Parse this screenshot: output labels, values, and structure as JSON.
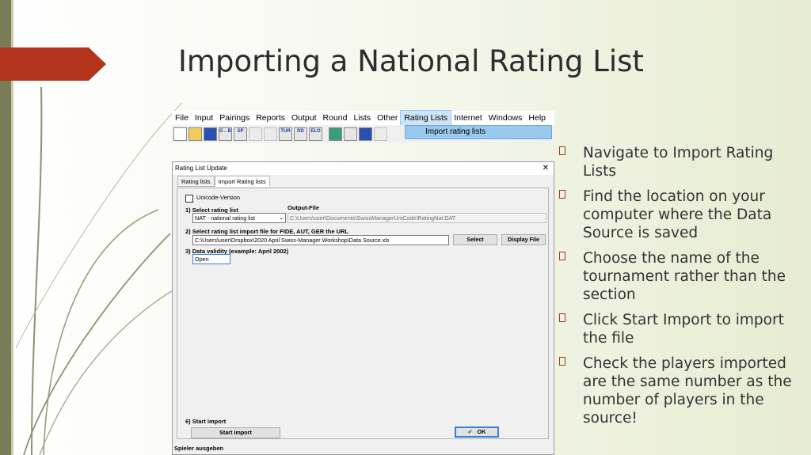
{
  "slide": {
    "title": "Importing a National Rating List",
    "bullets": [
      "Navigate to Import Rating Lists",
      "Find the location on your computer where the Data Source is saved",
      "Choose the name of the tournament rather than the section",
      "Click Start Import to import the file",
      "Check the players imported are the same number as the number of players in the source!"
    ],
    "accent_color": "#b3341c"
  },
  "app": {
    "menu": [
      "File",
      "Input",
      "Pairings",
      "Reports",
      "Output",
      "Round",
      "Lists",
      "Other",
      "Rating Lists",
      "Internet",
      "Windows",
      "Help"
    ],
    "active_menu": "Rating Lists",
    "dropdown_item": "Import rating lists",
    "toolbar_labels": [
      "",
      "",
      "",
      "G↔B",
      "SP",
      "",
      "",
      "TUR",
      "RD",
      "ELO"
    ]
  },
  "dialog": {
    "title": "Rating List Update",
    "close": "✕",
    "tabs": [
      "Rating lists",
      "Import Rating lists"
    ],
    "unicode_label": "Unicode-Version",
    "step1_label": "1) Select rating list",
    "output_file_label": "Output-File",
    "rating_list_value": "NAT - national rating list",
    "output_file_value": "C:\\Users\\user\\Documents\\SwissManagerUniCode\\RatingNat.DAT",
    "step2_label": "2) Select rating list import file for FIDE, AUT, GER the URL",
    "import_file_value": "C:\\Users\\user\\Dropbox\\2020 April Swiss-Manager Workshop\\Data Source.xls",
    "select_button": "Select",
    "display_button": "Display File",
    "step3_label": "3) Data validity (example: April 2002)",
    "validity_value": "Open",
    "step6_label": "6) Start import",
    "start_import_button": "Start import",
    "ok_button": "OK",
    "status_text": "Spieler ausgeben"
  }
}
